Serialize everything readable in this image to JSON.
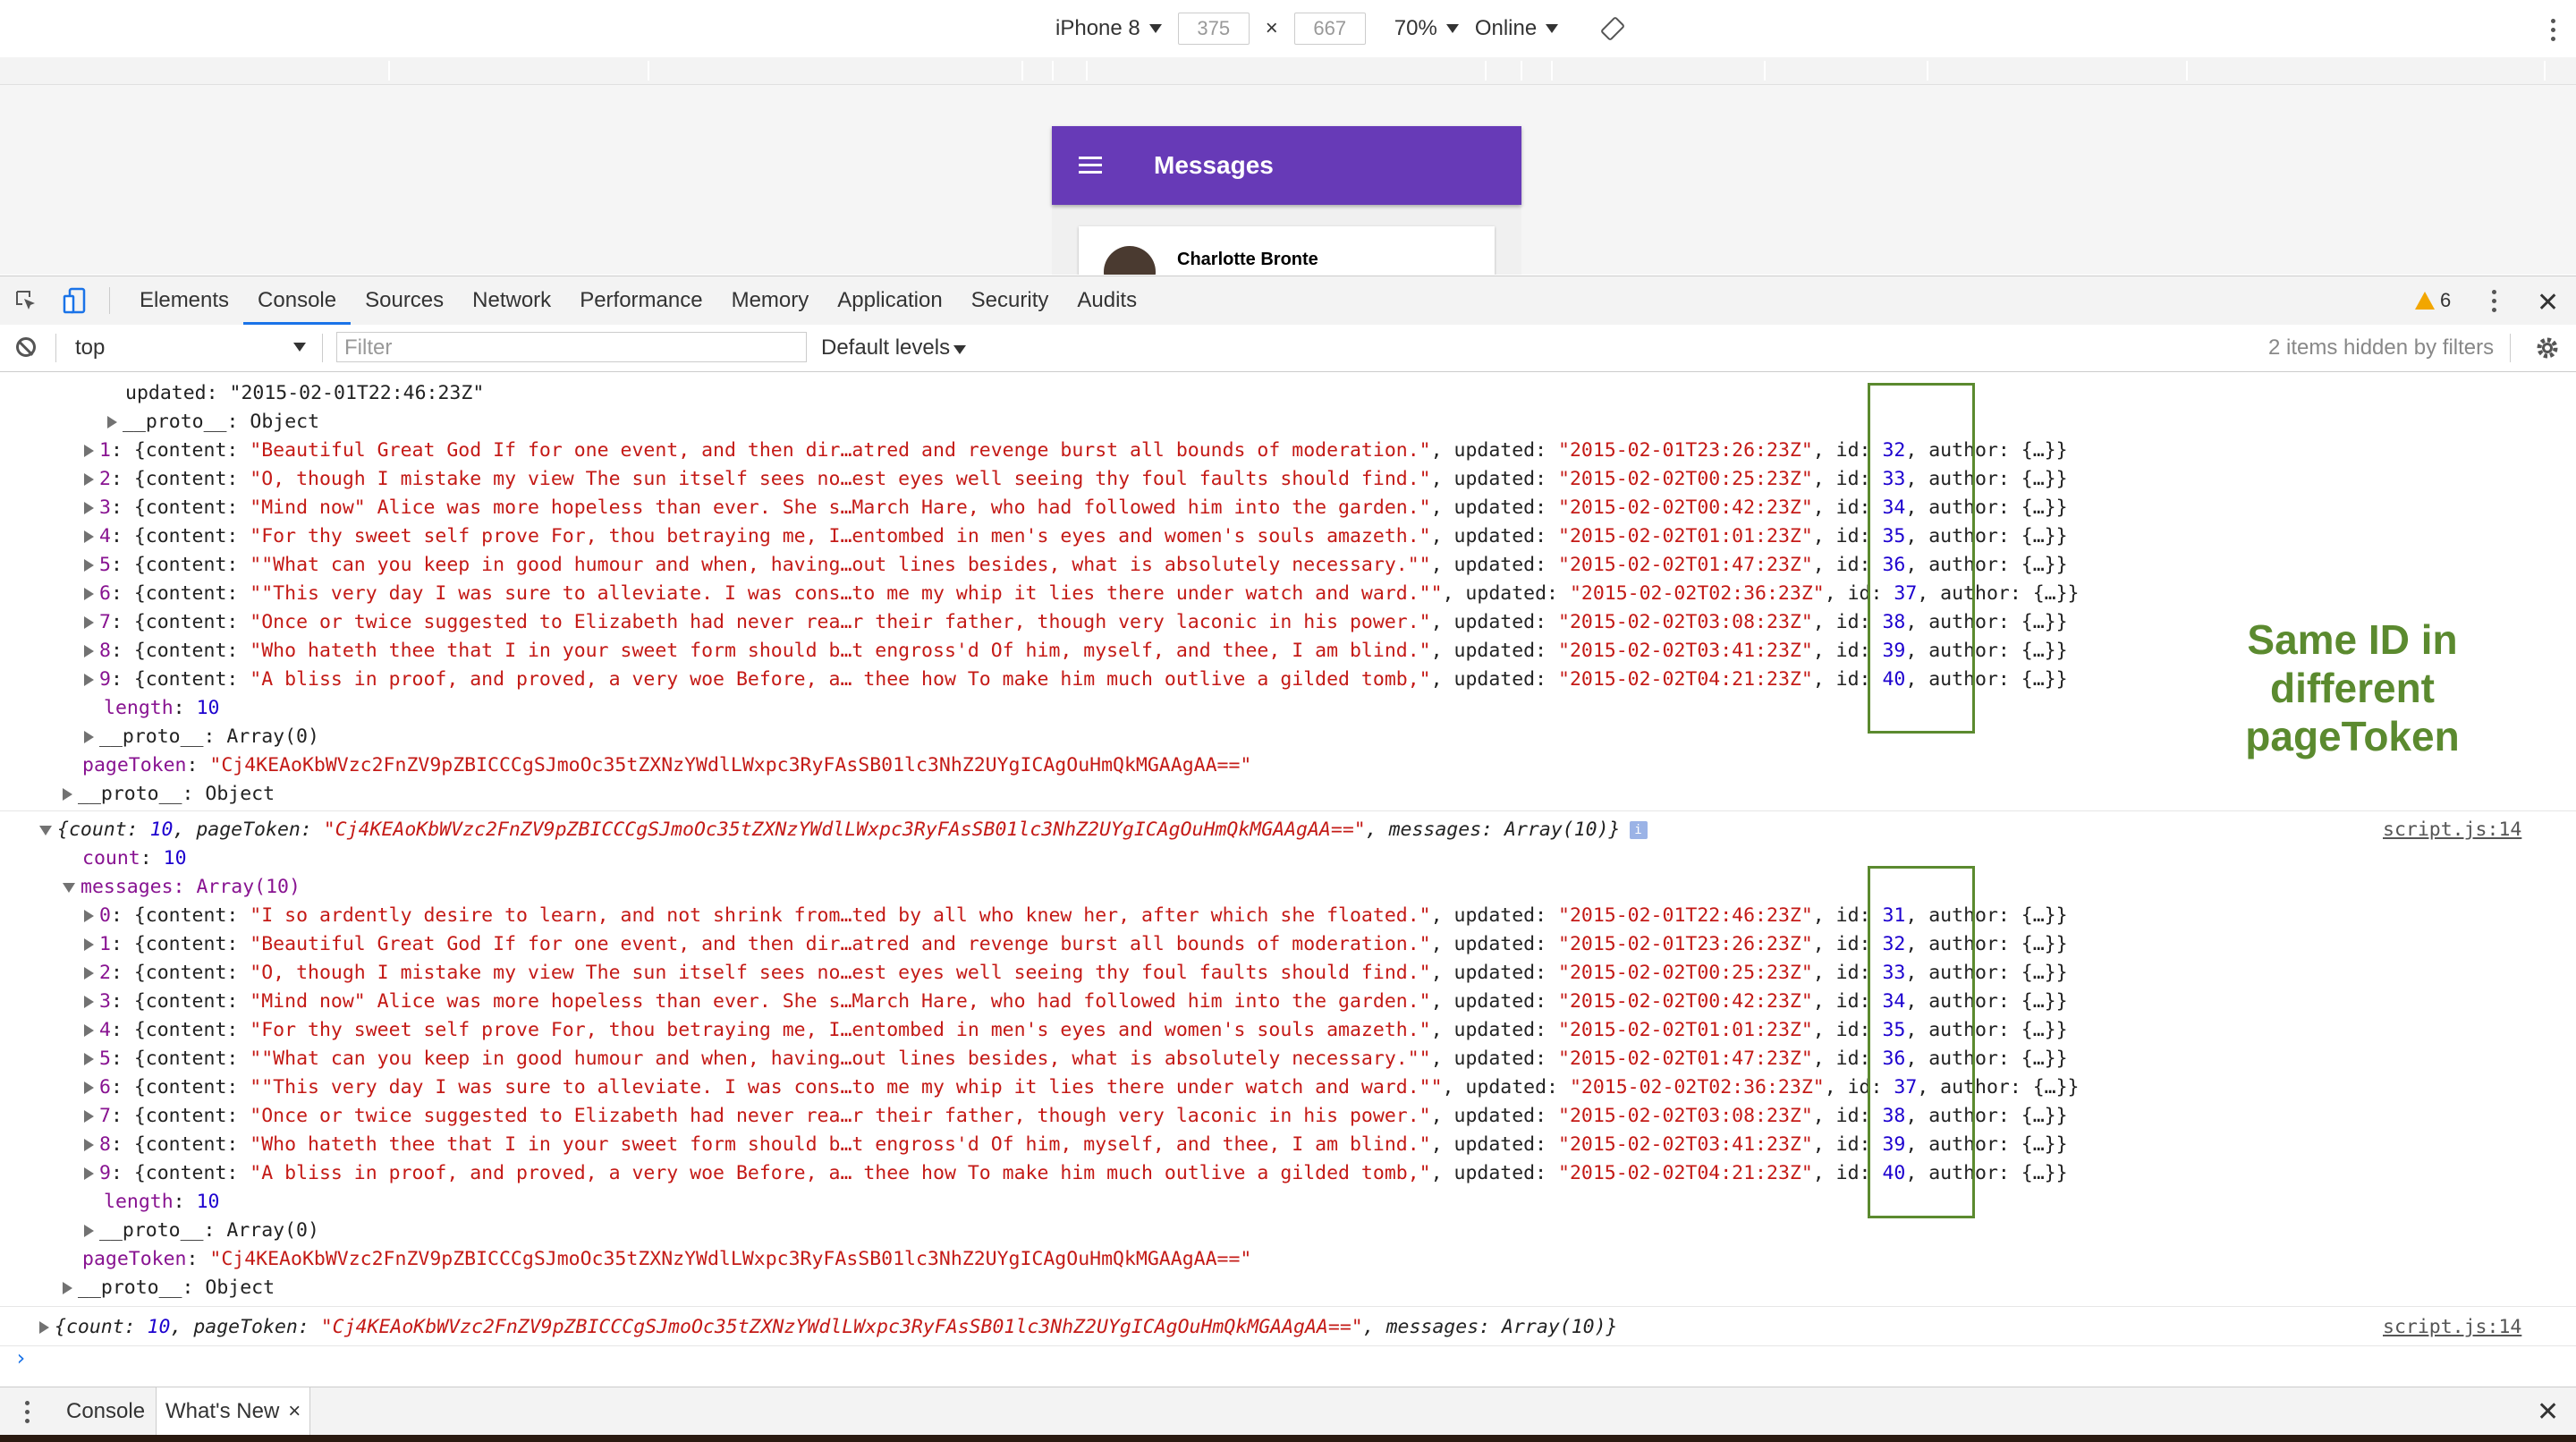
{
  "device_toolbar": {
    "device": "iPhone 8",
    "width": "375",
    "height": "667",
    "times": "×",
    "zoom": "70%",
    "network": "Online"
  },
  "app": {
    "title": "Messages",
    "card_name": "Charlotte Bronte",
    "bar_color": "#673ab7"
  },
  "devtools_tabs": [
    "Elements",
    "Console",
    "Sources",
    "Network",
    "Performance",
    "Memory",
    "Application",
    "Security",
    "Audits"
  ],
  "active_tab": "Console",
  "warnings_count": "6",
  "console_toolbar": {
    "context": "top",
    "filter_placeholder": "Filter",
    "levels": "Default levels",
    "hidden": "2 items hidden by filters"
  },
  "log1": {
    "updated_line": "updated: \"2015-02-01T22:46:23Z\"",
    "proto_line": "__proto__: Object",
    "messages": [
      {
        "idx": "1",
        "content": "\"Beautiful Great God If for one event, and then dir…atred and revenge burst all bounds of moderation.\"",
        "updated": "\"2015-02-01T23:26:23Z\"",
        "id": "32"
      },
      {
        "idx": "2",
        "content": "\"O, though I mistake my view The sun itself sees no…est eyes well seeing thy foul faults should find.\"",
        "updated": "\"2015-02-02T00:25:23Z\"",
        "id": "33"
      },
      {
        "idx": "3",
        "content": "\"Mind now\" Alice was more hopeless than ever. She s…March Hare, who had followed him into the garden.\"",
        "updated": "\"2015-02-02T00:42:23Z\"",
        "id": "34"
      },
      {
        "idx": "4",
        "content": "\"For thy sweet self prove For, thou betraying me, I…entombed in men's eyes and women's souls amazeth.\"",
        "updated": "\"2015-02-02T01:01:23Z\"",
        "id": "35"
      },
      {
        "idx": "5",
        "content": "\"\"What can you keep in good humour and when, having…out lines besides, what is absolutely necessary.\"\"",
        "updated": "\"2015-02-02T01:47:23Z\"",
        "id": "36"
      },
      {
        "idx": "6",
        "content": "\"\"This very day I was sure to alleviate. I was cons…to me my whip it lies there under watch and ward.\"\"",
        "updated": "\"2015-02-02T02:36:23Z\"",
        "id": "37"
      },
      {
        "idx": "7",
        "content": "\"Once or twice suggested to Elizabeth had never rea…r their father, though very laconic in his power.\"",
        "updated": "\"2015-02-02T03:08:23Z\"",
        "id": "38"
      },
      {
        "idx": "8",
        "content": "\"Who hateth thee that I in your sweet form should b…t engross'd Of him, myself, and thee, I am blind.\"",
        "updated": "\"2015-02-02T03:41:23Z\"",
        "id": "39"
      },
      {
        "idx": "9",
        "content": "\"A bliss in proof, and proved, a very woe Before, a… thee how To make him much outlive a gilded tomb,\"",
        "updated": "\"2015-02-02T04:21:23Z\"",
        "id": "40"
      }
    ],
    "length_label": "length",
    "length_value": "10",
    "array_proto": "__proto__: Array(0)",
    "page_token_label": "pageToken",
    "page_token": "\"Cj4KEAoKbWVzc2FnZV9pZBICCCgSJmoOc35tZXNzYWdlLWxpc3RyFAsSB01lc3NhZ2UYgICAgOuHmQkMGAAgAA==\"",
    "obj_proto": "__proto__: Object"
  },
  "log2": {
    "summary_count": "10",
    "summary_token": "\"Cj4KEAoKbWVzc2FnZV9pZBICCCgSJmoOc35tZXNzYWdlLWxpc3RyFAsSB01lc3NhZ2UYgICAgOuHmQkMGAAgAA==\"",
    "summary_messages": "Array(10)",
    "source": "script.js:14",
    "count_label": "count",
    "count_value": "10",
    "messages_label": "messages: Array(10)",
    "messages": [
      {
        "idx": "0",
        "content": "\"I so ardently desire to learn, and not shrink from…ted by all who knew her, after which she floated.\"",
        "updated": "\"2015-02-01T22:46:23Z\"",
        "id": "31"
      },
      {
        "idx": "1",
        "content": "\"Beautiful Great God If for one event, and then dir…atred and revenge burst all bounds of moderation.\"",
        "updated": "\"2015-02-01T23:26:23Z\"",
        "id": "32"
      },
      {
        "idx": "2",
        "content": "\"O, though I mistake my view The sun itself sees no…est eyes well seeing thy foul faults should find.\"",
        "updated": "\"2015-02-02T00:25:23Z\"",
        "id": "33"
      },
      {
        "idx": "3",
        "content": "\"Mind now\" Alice was more hopeless than ever. She s…March Hare, who had followed him into the garden.\"",
        "updated": "\"2015-02-02T00:42:23Z\"",
        "id": "34"
      },
      {
        "idx": "4",
        "content": "\"For thy sweet self prove For, thou betraying me, I…entombed in men's eyes and women's souls amazeth.\"",
        "updated": "\"2015-02-02T01:01:23Z\"",
        "id": "35"
      },
      {
        "idx": "5",
        "content": "\"\"What can you keep in good humour and when, having…out lines besides, what is absolutely necessary.\"\"",
        "updated": "\"2015-02-02T01:47:23Z\"",
        "id": "36"
      },
      {
        "idx": "6",
        "content": "\"\"This very day I was sure to alleviate. I was cons…to me my whip it lies there under watch and ward.\"\"",
        "updated": "\"2015-02-02T02:36:23Z\"",
        "id": "37"
      },
      {
        "idx": "7",
        "content": "\"Once or twice suggested to Elizabeth had never rea…r their father, though very laconic in his power.\"",
        "updated": "\"2015-02-02T03:08:23Z\"",
        "id": "38"
      },
      {
        "idx": "8",
        "content": "\"Who hateth thee that I in your sweet form should b…t engross'd Of him, myself, and thee, I am blind.\"",
        "updated": "\"2015-02-02T03:41:23Z\"",
        "id": "39"
      },
      {
        "idx": "9",
        "content": "\"A bliss in proof, and proved, a very woe Before, a… thee how To make him much outlive a gilded tomb,\"",
        "updated": "\"2015-02-02T04:21:23Z\"",
        "id": "40"
      }
    ],
    "length_label": "length",
    "length_value": "10",
    "array_proto": "__proto__: Array(0)",
    "page_token_label": "pageToken",
    "page_token": "\"Cj4KEAoKbWVzc2FnZV9pZBICCCgSJmoOc35tZXNzYWdlLWxpc3RyFAsSB01lc3NhZ2UYgICAgOuHmQkMGAAgAA==\"",
    "obj_proto": "__proto__: Object"
  },
  "log3": {
    "summary_count": "10",
    "summary_token": "\"Cj4KEAoKbWVzc2FnZV9pZBICCCgSJmoOc35tZXNzYWdlLWxpc3RyFAsSB01lc3NhZ2UYgICAgOuHmQkMGAAgAA==\"",
    "summary_messages": "Array(10)",
    "source": "script.js:14"
  },
  "annotation": "Same ID in\ndifferent\npageToken",
  "annotation_color": "#5b8a2f",
  "drawer": {
    "console": "Console",
    "whats_new": "What's New",
    "close": "×"
  }
}
